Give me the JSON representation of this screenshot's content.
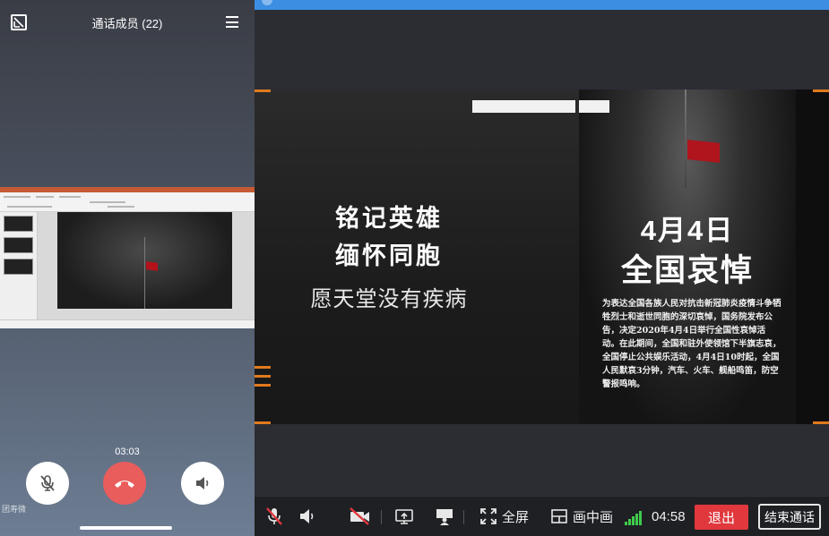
{
  "call": {
    "title": "通话成员 (22)",
    "timer": "03:03",
    "watermark": "团寿微",
    "shrink_icon": "shrink-window-icon",
    "menu_icon": "hamburger-menu-icon",
    "mute_icon": "mic-off-icon",
    "hangup_icon": "phone-hangup-icon",
    "speaker_icon": "speaker-icon",
    "hangup_color": "#e95d5d"
  },
  "slide": {
    "title_line1": "铭记英雄",
    "title_line2": "缅怀同胞",
    "subtitle": "愿天堂没有疾病",
    "mourn_date": "4月4日",
    "mourn_title": "全国哀悼",
    "mourn_body": "为表达全国各族人民对抗击新冠肺炎疫情斗争牺牲烈士和逝世同胞的深切哀悼，国务院发布公告，决定2020年4月4日举行全国性哀悼活动。在此期间，全国和驻外使领馆下半旗志哀，全国停止公共娱乐活动，4月4日10时起，全国人民默哀3分钟，汽车、火车、舰船鸣笛，防空警报鸣响。"
  },
  "toolbar": {
    "fullscreen_label": "全屏",
    "pip_label": "画中画",
    "duration": "04:58",
    "exit_label": "退出",
    "end_label": "结束通话",
    "exit_color": "#e0383d",
    "signal_color": "#3ecb4b"
  }
}
